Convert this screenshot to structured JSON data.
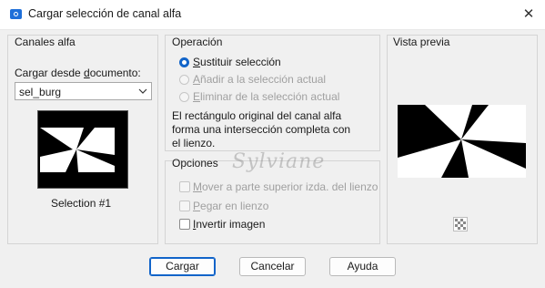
{
  "window": {
    "title": "Cargar selección de canal alfa",
    "close_glyph": "✕"
  },
  "canales": {
    "group_label": "Canales alfa",
    "source_label": "Cargar desde documento:",
    "source_value": "sel_burg",
    "selection_name": "Selection #1"
  },
  "operacion": {
    "group_label": "Operación",
    "options": [
      {
        "label": "Sustituir selección",
        "checked": true,
        "enabled": true
      },
      {
        "label": "Añadir a la selección actual",
        "checked": false,
        "enabled": false
      },
      {
        "label": "Eliminar de la selección actual",
        "checked": false,
        "enabled": false
      }
    ],
    "description": "El rectángulo original del canal alfa forma una intersección completa con el lienzo."
  },
  "opciones": {
    "group_label": "Opciones",
    "checks": [
      {
        "label": "Mover a parte superior izda. del lienzo",
        "checked": false,
        "enabled": false
      },
      {
        "label": "Pegar en lienzo",
        "checked": false,
        "enabled": false
      },
      {
        "label": "Invertir imagen",
        "checked": false,
        "enabled": true
      }
    ]
  },
  "preview": {
    "group_label": "Vista previa"
  },
  "watermark": "Sylviane",
  "buttons": {
    "ok": "Cargar",
    "cancel": "Cancelar",
    "help": "Ayuda"
  },
  "icons": {
    "app": "selection-app-icon",
    "preview_toggle": "checkerboard-icon",
    "dropdown": "chevron-down-icon"
  },
  "colors": {
    "accent": "#1164c9"
  }
}
